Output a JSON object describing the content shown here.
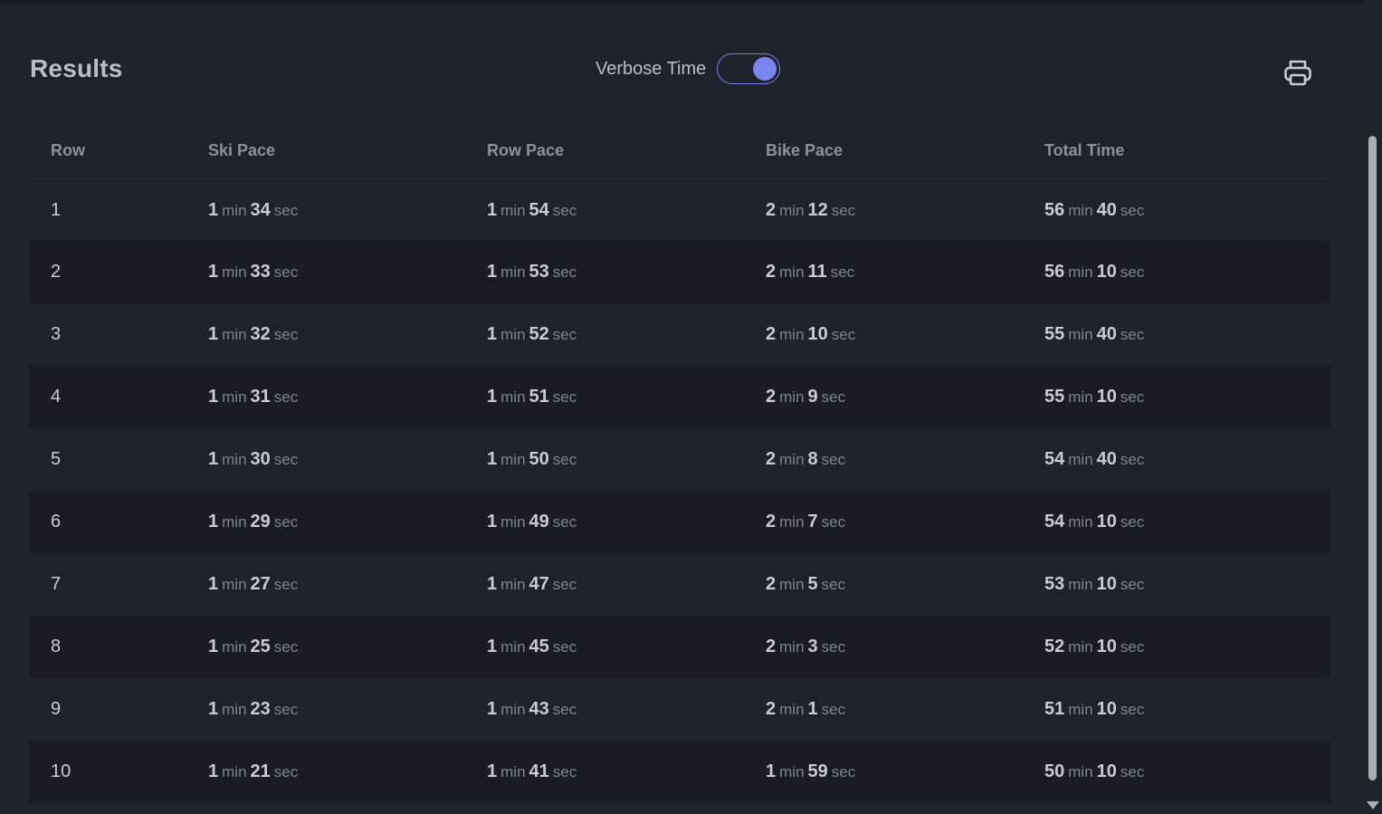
{
  "header": {
    "title": "Results",
    "toggle_label": "Verbose Time",
    "toggle_on": true,
    "print_icon": "printer-icon"
  },
  "table": {
    "columns": [
      "Row",
      "Ski Pace",
      "Row Pace",
      "Bike Pace",
      "Total Time"
    ],
    "units": {
      "min": "min",
      "sec": "sec"
    },
    "rows": [
      {
        "row": "1",
        "ski": [
          "1",
          "34"
        ],
        "rowpace": [
          "1",
          "54"
        ],
        "bike": [
          "2",
          "12"
        ],
        "total": [
          "56",
          "40"
        ]
      },
      {
        "row": "2",
        "ski": [
          "1",
          "33"
        ],
        "rowpace": [
          "1",
          "53"
        ],
        "bike": [
          "2",
          "11"
        ],
        "total": [
          "56",
          "10"
        ]
      },
      {
        "row": "3",
        "ski": [
          "1",
          "32"
        ],
        "rowpace": [
          "1",
          "52"
        ],
        "bike": [
          "2",
          "10"
        ],
        "total": [
          "55",
          "40"
        ]
      },
      {
        "row": "4",
        "ski": [
          "1",
          "31"
        ],
        "rowpace": [
          "1",
          "51"
        ],
        "bike": [
          "2",
          "9"
        ],
        "total": [
          "55",
          "10"
        ]
      },
      {
        "row": "5",
        "ski": [
          "1",
          "30"
        ],
        "rowpace": [
          "1",
          "50"
        ],
        "bike": [
          "2",
          "8"
        ],
        "total": [
          "54",
          "40"
        ]
      },
      {
        "row": "6",
        "ski": [
          "1",
          "29"
        ],
        "rowpace": [
          "1",
          "49"
        ],
        "bike": [
          "2",
          "7"
        ],
        "total": [
          "54",
          "10"
        ]
      },
      {
        "row": "7",
        "ski": [
          "1",
          "27"
        ],
        "rowpace": [
          "1",
          "47"
        ],
        "bike": [
          "2",
          "5"
        ],
        "total": [
          "53",
          "10"
        ]
      },
      {
        "row": "8",
        "ski": [
          "1",
          "25"
        ],
        "rowpace": [
          "1",
          "45"
        ],
        "bike": [
          "2",
          "3"
        ],
        "total": [
          "52",
          "10"
        ]
      },
      {
        "row": "9",
        "ski": [
          "1",
          "23"
        ],
        "rowpace": [
          "1",
          "43"
        ],
        "bike": [
          "2",
          "1"
        ],
        "total": [
          "51",
          "10"
        ]
      },
      {
        "row": "10",
        "ski": [
          "1",
          "21"
        ],
        "rowpace": [
          "1",
          "41"
        ],
        "bike": [
          "1",
          "59"
        ],
        "total": [
          "50",
          "10"
        ]
      }
    ]
  },
  "colors": {
    "background": "#1e232b",
    "row_alt": "#191d23",
    "accent": "#7c84f0"
  }
}
